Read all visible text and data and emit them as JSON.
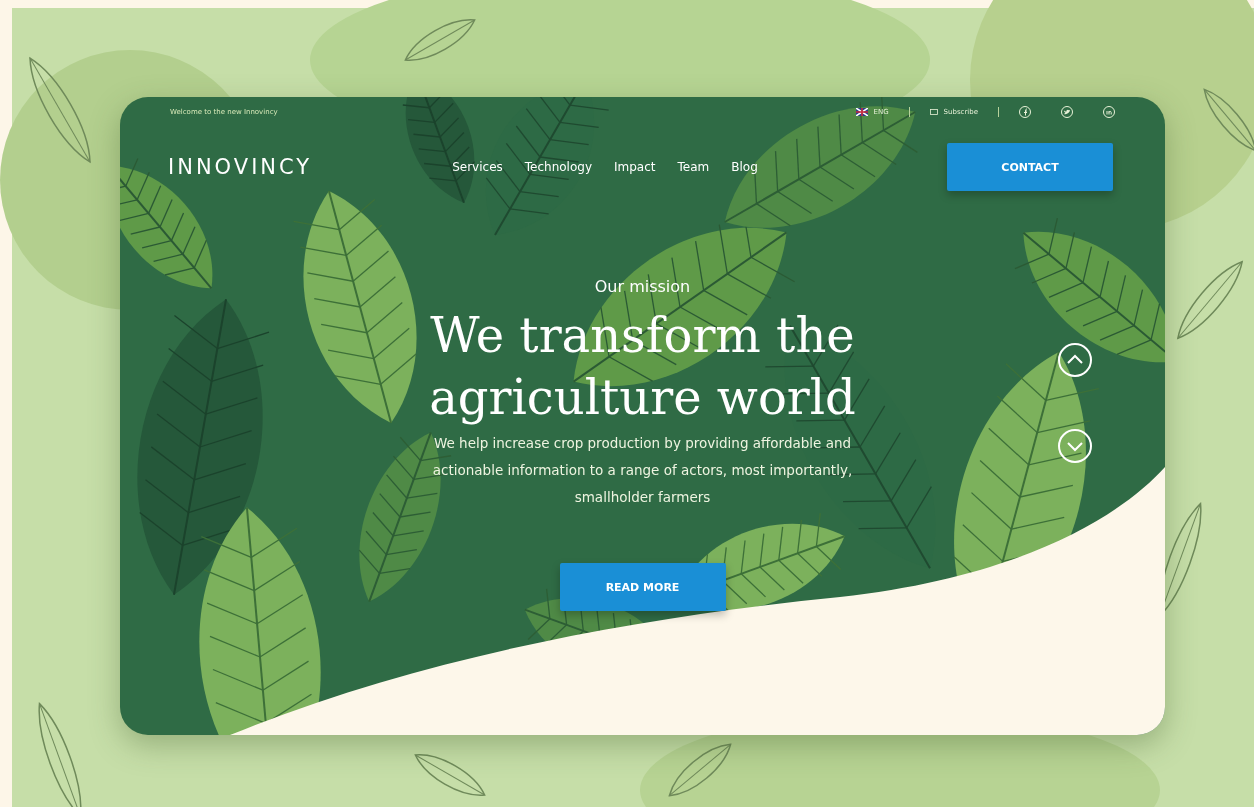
{
  "top_bar": {
    "welcome": "Welcome to the new Innovincy",
    "language": "ENG",
    "subscribe": "Subscribe"
  },
  "nav": {
    "logo": "INNOVINCY",
    "links": [
      {
        "label": "Services"
      },
      {
        "label": "Technology"
      },
      {
        "label": "Impact"
      },
      {
        "label": "Team"
      },
      {
        "label": "Blog"
      }
    ],
    "contact": "CONTACT"
  },
  "hero": {
    "eyebrow": "Our mission",
    "title_lines": [
      "We transform the",
      "agriculture world"
    ],
    "text": "We help increase crop production by providing affordable and actionable information to a range of actors, most importantly, smallholder farmers",
    "button": "READ MORE"
  }
}
